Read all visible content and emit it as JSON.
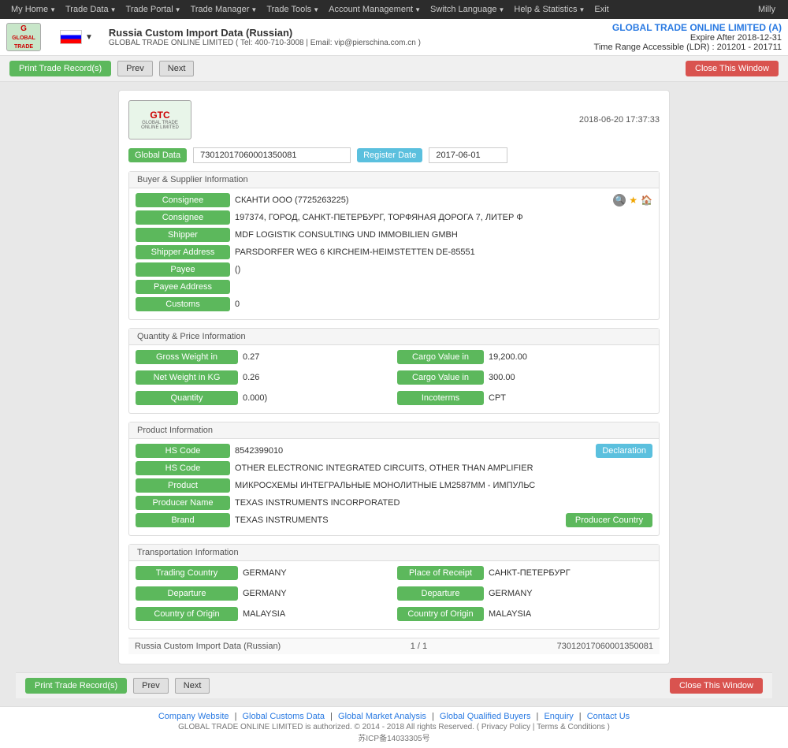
{
  "topNav": {
    "items": [
      {
        "label": "My Home",
        "arrow": true
      },
      {
        "label": "Trade Data",
        "arrow": true
      },
      {
        "label": "Trade Portal",
        "arrow": true
      },
      {
        "label": "Trade Manager",
        "arrow": true
      },
      {
        "label": "Trade Tools",
        "arrow": true
      },
      {
        "label": "Account Management",
        "arrow": true
      },
      {
        "label": "Switch Language",
        "arrow": true
      },
      {
        "label": "Help & Statistics",
        "arrow": true
      },
      {
        "label": "Exit",
        "arrow": false
      }
    ],
    "user": "Milly"
  },
  "header": {
    "logo": "GTC",
    "logoSub": "GLOBAL TRADE ONLINE LIMITED",
    "flag": "Russia",
    "title": "Russia Custom Import Data (Russian)",
    "subtitle": "GLOBAL TRADE ONLINE LIMITED ( Tel: 400-710-3008 | Email: vip@pierschina.com.cn )",
    "company": "GLOBAL TRADE ONLINE LIMITED (A)",
    "expire": "Expire After 2018-12-31",
    "timeRange": "Time Range Accessible (LDR) : 201201 - 201711"
  },
  "toolbar": {
    "printBtn": "Print Trade Record(s)",
    "prevBtn": "Prev",
    "nextBtn": "Next",
    "closeBtn": "Close This Window"
  },
  "record": {
    "datetime": "2018-06-20 17:37:33",
    "globalDataLabel": "Global Data",
    "globalDataValue": "73012017060001350081",
    "registerDateLabel": "Register Date",
    "registerDateValue": "2017-06-01",
    "buyerSupplierSection": "Buyer & Supplier Information",
    "fields": {
      "consigneeName": "СКАНТИ ООО (7725263225)",
      "consigneeAddr": "197374, ГОРОД, САНКТ-ПЕТЕРБУРГ, ТОРФЯНАЯ ДОРОГА 7, ЛИТЕР Ф",
      "shipper": "MDF LOGISTIK CONSULTING UND IMMOBILIEN GMBH",
      "shipperAddr": "PARSDORFER WEG 6 KIRCHEIM-HEIMSTETTEN DE-85551",
      "payee": "()",
      "payeeAddr": "",
      "customs": "0"
    },
    "quantitySection": "Quantity & Price Information",
    "quantityFields": {
      "grossWeight": "0.27",
      "cargoValue1": "19,200.00",
      "netWeight": "0.26",
      "cargoValue2": "300.00",
      "quantity": "0.000)",
      "incoterms": "CPT"
    },
    "productSection": "Product Information",
    "productFields": {
      "hsCode1": "8542399010",
      "hsCode2": "OTHER ELECTRONIC INTEGRATED CIRCUITS, OTHER THAN AMPLIFIER",
      "product": "МИКРОСХЕМЫ ИНТЕГРАЛЬНЫЕ МОНОЛИТНЫЕ LM2587ММ - ИМПУЛЬС",
      "producerName": "TEXAS INSTRUMENTS INCORPORATED",
      "brand": "TEXAS INSTRUMENTS"
    },
    "transportSection": "Transportation Information",
    "transportFields": {
      "tradingCountry": "GERMANY",
      "placeOfReceipt": "САНКТ-ПЕТЕРБУРГ",
      "departure1": "GERMANY",
      "departure2": "GERMANY",
      "countryOfOrigin1": "MALAYSIA",
      "countryOfOrigin2": "MALAYSIA"
    },
    "footerLeft": "Russia Custom Import Data (Russian)",
    "footerMiddle": "1 / 1",
    "footerRight": "73012017060001350081"
  },
  "labels": {
    "consignee": "Consignee",
    "consigneeAddr": "Consignee",
    "shipper": "Shipper",
    "shipperAddress": "Shipper Address",
    "payee": "Payee",
    "payeeAddress": "Payee Address",
    "customs": "Customs",
    "grossWeight": "Gross Weight in",
    "cargoValue1": "Cargo Value in",
    "netWeight": "Net Weight in KG",
    "cargoValue2": "Cargo Value in",
    "quantity": "Quantity",
    "incoterms": "Incoterms",
    "hsCode": "HS Code",
    "declaration": "Declaration",
    "product": "Product",
    "producerName": "Producer Name",
    "brand": "Brand",
    "producerCountry": "Producer Country",
    "tradingCountry": "Trading Country",
    "placeOfReceipt": "Place of Receipt",
    "departure": "Departure",
    "departureRight": "Departure",
    "countryOfOrigin": "Country of Origin",
    "countryOfOriginRight": "Country of Origin"
  },
  "siteFooter": {
    "links": [
      "Company Website",
      "Global Customs Data",
      "Global Market Analysis",
      "Global Qualified Buyers",
      "Enquiry",
      "Contact Us"
    ],
    "copyright": "GLOBAL TRADE ONLINE LIMITED is authorized. © 2014 - 2018 All rights Reserved.  ( Privacy Policy | Terms & Conditions )",
    "icp": "苏ICP备14033305号"
  }
}
